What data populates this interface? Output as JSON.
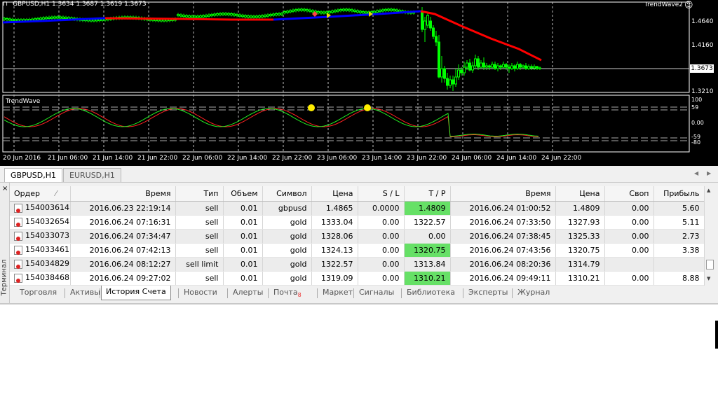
{
  "chart": {
    "menu_icon": "⊓",
    "symbol_title": "GBPUSD,H1  1.3634 1.3687 1.3619 1.3673",
    "indicator_right": "TrendWave2",
    "indicator_sub": "TrendWave",
    "smiley_icon": "☺",
    "current_price": "1.3673",
    "price_labels": [
      "1.4640",
      "1.4160",
      "1.3210"
    ],
    "ind_labels": [
      "100",
      "59",
      "0.00",
      "-59",
      "-80"
    ],
    "time_labels": [
      "20 Jun 2016",
      "21 Jun 06:00",
      "21 Jun 14:00",
      "21 Jun 22:00",
      "22 Jun 06:00",
      "22 Jun 14:00",
      "22 Jun 22:00",
      "23 Jun 06:00",
      "23 Jun 14:00",
      "23 Jun 22:00",
      "24 Jun 06:00",
      "24 Jun 14:00",
      "24 Jun 22:00"
    ],
    "colors": {
      "bull": "#00ff00",
      "bear": "#ff0000",
      "trend_up": "#0000ff",
      "trend_down": "#ff0000",
      "bg": "#000000"
    }
  },
  "chart_tabs": [
    "GBPUSD,H1",
    "EURUSD,H1"
  ],
  "terminal": {
    "close_icon": "×",
    "side_label": "Терминал",
    "columns": [
      "Ордер",
      "Время",
      "Тип",
      "Объем",
      "Символ",
      "Цена",
      "S / L",
      "T / P",
      "Время",
      "Цена",
      "Своп",
      "Прибыль"
    ],
    "rows": [
      {
        "order": "154003614",
        "open_time": "2016.06.23 22:19:14",
        "type": "sell",
        "volume": "0.01",
        "symbol": "gbpusd",
        "price": "1.4865",
        "sl": "0.0000",
        "tp": "1.4809",
        "close_time": "2016.06.24 01:00:52",
        "close_price": "1.4809",
        "swap": "0.00",
        "profit": "5.60",
        "tp_hit": true
      },
      {
        "order": "154032654",
        "open_time": "2016.06.24 07:16:31",
        "type": "sell",
        "volume": "0.01",
        "symbol": "gold",
        "price": "1333.04",
        "sl": "0.00",
        "tp": "1322.57",
        "close_time": "2016.06.24 07:33:50",
        "close_price": "1327.93",
        "swap": "0.00",
        "profit": "5.11",
        "tp_hit": false
      },
      {
        "order": "154033073",
        "open_time": "2016.06.24 07:34:47",
        "type": "sell",
        "volume": "0.01",
        "symbol": "gold",
        "price": "1328.06",
        "sl": "0.00",
        "tp": "0.00",
        "close_time": "2016.06.24 07:38:45",
        "close_price": "1325.33",
        "swap": "0.00",
        "profit": "2.73",
        "tp_hit": false
      },
      {
        "order": "154033461",
        "open_time": "2016.06.24 07:42:13",
        "type": "sell",
        "volume": "0.01",
        "symbol": "gold",
        "price": "1324.13",
        "sl": "0.00",
        "tp": "1320.75",
        "close_time": "2016.06.24 07:43:56",
        "close_price": "1320.75",
        "swap": "0.00",
        "profit": "3.38",
        "tp_hit": true
      },
      {
        "order": "154034829",
        "open_time": "2016.06.24 08:12:27",
        "type": "sell limit",
        "volume": "0.01",
        "symbol": "gold",
        "price": "1322.57",
        "sl": "0.00",
        "tp": "1313.84",
        "close_time": "2016.06.24 08:20:36",
        "close_price": "1314.79",
        "swap": "",
        "profit": "",
        "tp_hit": false
      },
      {
        "order": "154038468",
        "open_time": "2016.06.24 09:27:02",
        "type": "sell",
        "volume": "0.01",
        "symbol": "gold",
        "price": "1319.09",
        "sl": "0.00",
        "tp": "1310.21",
        "close_time": "2016.06.24 09:49:11",
        "close_price": "1310.21",
        "swap": "0.00",
        "profit": "8.88",
        "tp_hit": true
      }
    ],
    "tabs": [
      {
        "label": "Торговля",
        "badge": ""
      },
      {
        "label": "Активы",
        "badge": ""
      },
      {
        "label": "История Счета",
        "badge": ""
      },
      {
        "label": "Новости",
        "badge": ""
      },
      {
        "label": "Алерты",
        "badge": ""
      },
      {
        "label": "Почта",
        "badge": "8"
      },
      {
        "label": "Маркет",
        "badge": ""
      },
      {
        "label": "Сигналы",
        "badge": ""
      },
      {
        "label": "Библиотека",
        "badge": ""
      },
      {
        "label": "Эксперты",
        "badge": ""
      },
      {
        "label": "Журнал",
        "badge": ""
      }
    ],
    "active_tab": 2
  }
}
